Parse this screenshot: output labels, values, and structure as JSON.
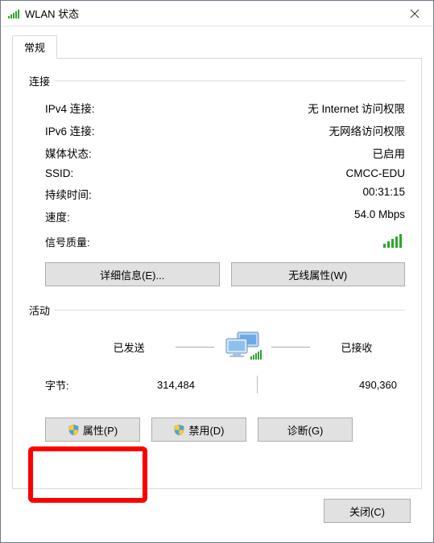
{
  "title": "WLAN 状态",
  "tab": {
    "general": "常规"
  },
  "connection": {
    "header": "连接",
    "rows": {
      "ipv4_label": "IPv4 连接:",
      "ipv4_value": "无 Internet 访问权限",
      "ipv6_label": "IPv6 连接:",
      "ipv6_value": "无网络访问权限",
      "media_label": "媒体状态:",
      "media_value": "已启用",
      "ssid_label": "SSID:",
      "ssid_value": "CMCC-EDU",
      "duration_label": "持续时间:",
      "duration_value": "00:31:15",
      "speed_label": "速度:",
      "speed_value": "54.0 Mbps",
      "signal_label": "信号质量:"
    },
    "buttons": {
      "details": "详细信息(E)...",
      "wireless": "无线属性(W)"
    }
  },
  "activity": {
    "header": "活动",
    "sent_label": "已发送",
    "recv_label": "已接收",
    "bytes_label": "字节:",
    "bytes_sent": "314,484",
    "bytes_recv": "490,360",
    "buttons": {
      "properties": "属性(P)",
      "disable": "禁用(D)",
      "diagnose": "诊断(G)"
    }
  },
  "footer": {
    "close": "关闭(C)"
  }
}
